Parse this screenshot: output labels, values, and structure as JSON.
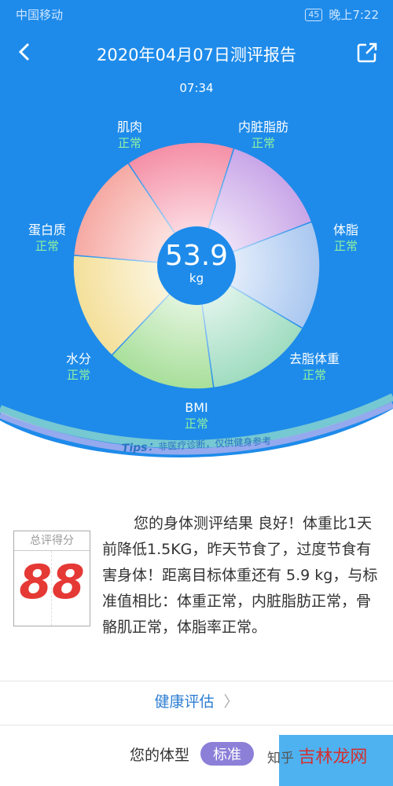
{
  "status": {
    "carrier": "中国移动",
    "battery": "45",
    "time": "晚上7:22"
  },
  "header": {
    "title": "2020年04月07日测评报告"
  },
  "report_time": "07:34",
  "center": {
    "value": "53.9",
    "unit": "kg"
  },
  "segments": [
    {
      "name": "肌肉",
      "status": "正常"
    },
    {
      "name": "内脏脂肪",
      "status": "正常"
    },
    {
      "name": "体脂",
      "status": "正常"
    },
    {
      "name": "去脂体重",
      "status": "正常"
    },
    {
      "name": "BMI",
      "status": "正常"
    },
    {
      "name": "水分",
      "status": "正常"
    },
    {
      "name": "蛋白质",
      "status": "正常"
    }
  ],
  "tips": {
    "label": "Tips：",
    "text": "非医疗诊断，仅供健身参考"
  },
  "score": {
    "label": "总评得分",
    "value": "88"
  },
  "description": "您的身体测评结果 良好！体重比1天前降低1.5KG，昨天节食了，过度节食有害身体！距离目标体重还有 5.9 kg，与标准值相比：体重正常，内脏脂肪正常，骨骼肌正常，体脂率正常。",
  "health_eval": "健康评估",
  "body_type": {
    "label": "您的体型",
    "value": "标准"
  },
  "watermark": {
    "a": "知乎",
    "b": "吉林龙网"
  },
  "colors": {
    "bg_blue": "#1E8BEA",
    "status_green": "#8EF0A0",
    "score_red": "#E53935",
    "pill": "#8B7FD8"
  }
}
